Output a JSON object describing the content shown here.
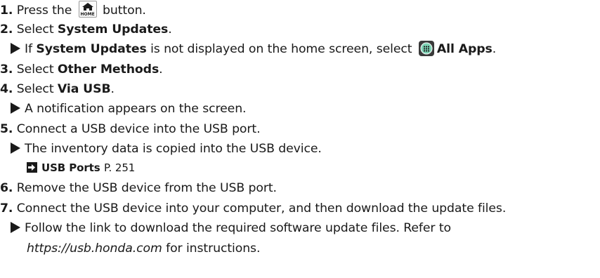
{
  "steps": [
    {
      "num": "1.",
      "pre": "Press the ",
      "post": " button.",
      "icon_name": "home-button-icon",
      "icon_text": "HOME"
    },
    {
      "num": "2.",
      "pre": "Select ",
      "bold": "System Updates",
      "post": "."
    },
    {
      "num": "3.",
      "pre": "Select ",
      "bold": "Other Methods",
      "post": "."
    },
    {
      "num": "4.",
      "pre": "Select ",
      "bold": "Via USB",
      "post": "."
    },
    {
      "num": "5.",
      "text": "Connect a USB device into the USB port."
    },
    {
      "num": "6.",
      "text": "Remove the USB device from the USB port."
    },
    {
      "num": "7.",
      "text": "Connect the USB device into your computer, and then download the update files."
    }
  ],
  "notes": {
    "step2": {
      "pre": "If ",
      "bold1": "System Updates",
      "mid": " is not displayed on the home screen, select ",
      "icon_name": "all-apps-icon",
      "bold2": "All Apps",
      "post": "."
    },
    "step4": {
      "text": "A notification appears on the screen."
    },
    "step5": {
      "text": "The inventory data is copied into the USB device."
    },
    "step5_xref": {
      "label": "USB Ports",
      "page": "P. 251"
    },
    "step7_line1": "Follow the link to download the required software update files. Refer to",
    "step7_url": "https://usb.honda.com",
    "step7_post": " for instructions."
  }
}
